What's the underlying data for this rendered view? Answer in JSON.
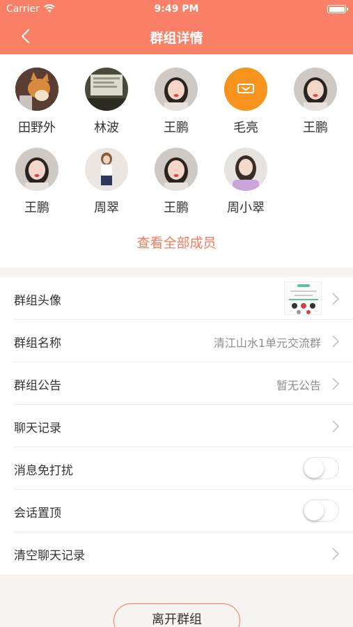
{
  "status_bar": {
    "carrier": "Carrier",
    "time": "9:49 PM"
  },
  "nav": {
    "title": "群组详情"
  },
  "members": [
    {
      "name": "田野外",
      "avatar": "dog-photo"
    },
    {
      "name": "林波",
      "avatar": "monitor-photo"
    },
    {
      "name": "王鹏",
      "avatar": "girl-selfie"
    },
    {
      "name": "毛亮",
      "avatar": "orange-logo"
    },
    {
      "name": "王鹏",
      "avatar": "girl-selfie"
    },
    {
      "name": "王鹏",
      "avatar": "girl-selfie"
    },
    {
      "name": "周翠",
      "avatar": "woman-standing"
    },
    {
      "name": "王鹏",
      "avatar": "girl-selfie"
    },
    {
      "name": "周小翠",
      "avatar": "girl-purple"
    }
  ],
  "view_all": "查看全部成员",
  "settings": {
    "group_avatar_label": "群组头像",
    "group_name_label": "群组名称",
    "group_name_value": "清江山水1单元交流群",
    "announcement_label": "群组公告",
    "announcement_value": "暂无公告",
    "history_label": "聊天记录",
    "mute_label": "消息免打扰",
    "mute_on": false,
    "pin_label": "会话置顶",
    "pin_on": false,
    "clear_label": "清空聊天记录"
  },
  "leave_button": "离开群组",
  "colors": {
    "accent": "#f98066",
    "link": "#f47b5a"
  }
}
